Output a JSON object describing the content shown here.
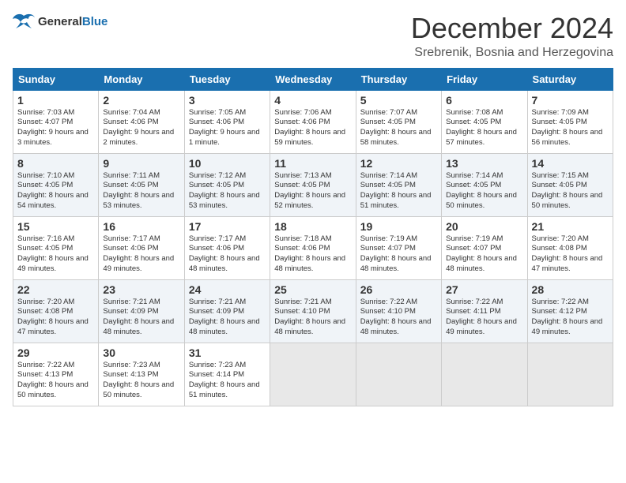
{
  "header": {
    "logo": {
      "general": "General",
      "blue": "Blue"
    },
    "title": "December 2024",
    "location": "Srebrenik, Bosnia and Herzegovina"
  },
  "calendar": {
    "days_of_week": [
      "Sunday",
      "Monday",
      "Tuesday",
      "Wednesday",
      "Thursday",
      "Friday",
      "Saturday"
    ],
    "weeks": [
      [
        null,
        {
          "day": "2",
          "sunrise": "Sunrise: 7:04 AM",
          "sunset": "Sunset: 4:06 PM",
          "daylight": "Daylight: 9 hours and 2 minutes."
        },
        {
          "day": "3",
          "sunrise": "Sunrise: 7:05 AM",
          "sunset": "Sunset: 4:06 PM",
          "daylight": "Daylight: 9 hours and 1 minute."
        },
        {
          "day": "4",
          "sunrise": "Sunrise: 7:06 AM",
          "sunset": "Sunset: 4:06 PM",
          "daylight": "Daylight: 8 hours and 59 minutes."
        },
        {
          "day": "5",
          "sunrise": "Sunrise: 7:07 AM",
          "sunset": "Sunset: 4:05 PM",
          "daylight": "Daylight: 8 hours and 58 minutes."
        },
        {
          "day": "6",
          "sunrise": "Sunrise: 7:08 AM",
          "sunset": "Sunset: 4:05 PM",
          "daylight": "Daylight: 8 hours and 57 minutes."
        },
        {
          "day": "7",
          "sunrise": "Sunrise: 7:09 AM",
          "sunset": "Sunset: 4:05 PM",
          "daylight": "Daylight: 8 hours and 56 minutes."
        }
      ],
      [
        {
          "day": "1",
          "sunrise": "Sunrise: 7:03 AM",
          "sunset": "Sunset: 4:07 PM",
          "daylight": "Daylight: 9 hours and 3 minutes."
        },
        {
          "day": "9",
          "sunrise": "Sunrise: 7:11 AM",
          "sunset": "Sunset: 4:05 PM",
          "daylight": "Daylight: 8 hours and 53 minutes."
        },
        {
          "day": "10",
          "sunrise": "Sunrise: 7:12 AM",
          "sunset": "Sunset: 4:05 PM",
          "daylight": "Daylight: 8 hours and 53 minutes."
        },
        {
          "day": "11",
          "sunrise": "Sunrise: 7:13 AM",
          "sunset": "Sunset: 4:05 PM",
          "daylight": "Daylight: 8 hours and 52 minutes."
        },
        {
          "day": "12",
          "sunrise": "Sunrise: 7:14 AM",
          "sunset": "Sunset: 4:05 PM",
          "daylight": "Daylight: 8 hours and 51 minutes."
        },
        {
          "day": "13",
          "sunrise": "Sunrise: 7:14 AM",
          "sunset": "Sunset: 4:05 PM",
          "daylight": "Daylight: 8 hours and 50 minutes."
        },
        {
          "day": "14",
          "sunrise": "Sunrise: 7:15 AM",
          "sunset": "Sunset: 4:05 PM",
          "daylight": "Daylight: 8 hours and 50 minutes."
        }
      ],
      [
        {
          "day": "8",
          "sunrise": "Sunrise: 7:10 AM",
          "sunset": "Sunset: 4:05 PM",
          "daylight": "Daylight: 8 hours and 54 minutes."
        },
        {
          "day": "16",
          "sunrise": "Sunrise: 7:17 AM",
          "sunset": "Sunset: 4:06 PM",
          "daylight": "Daylight: 8 hours and 49 minutes."
        },
        {
          "day": "17",
          "sunrise": "Sunrise: 7:17 AM",
          "sunset": "Sunset: 4:06 PM",
          "daylight": "Daylight: 8 hours and 48 minutes."
        },
        {
          "day": "18",
          "sunrise": "Sunrise: 7:18 AM",
          "sunset": "Sunset: 4:06 PM",
          "daylight": "Daylight: 8 hours and 48 minutes."
        },
        {
          "day": "19",
          "sunrise": "Sunrise: 7:19 AM",
          "sunset": "Sunset: 4:07 PM",
          "daylight": "Daylight: 8 hours and 48 minutes."
        },
        {
          "day": "20",
          "sunrise": "Sunrise: 7:19 AM",
          "sunset": "Sunset: 4:07 PM",
          "daylight": "Daylight: 8 hours and 48 minutes."
        },
        {
          "day": "21",
          "sunrise": "Sunrise: 7:20 AM",
          "sunset": "Sunset: 4:08 PM",
          "daylight": "Daylight: 8 hours and 47 minutes."
        }
      ],
      [
        {
          "day": "15",
          "sunrise": "Sunrise: 7:16 AM",
          "sunset": "Sunset: 4:05 PM",
          "daylight": "Daylight: 8 hours and 49 minutes."
        },
        {
          "day": "23",
          "sunrise": "Sunrise: 7:21 AM",
          "sunset": "Sunset: 4:09 PM",
          "daylight": "Daylight: 8 hours and 48 minutes."
        },
        {
          "day": "24",
          "sunrise": "Sunrise: 7:21 AM",
          "sunset": "Sunset: 4:09 PM",
          "daylight": "Daylight: 8 hours and 48 minutes."
        },
        {
          "day": "25",
          "sunrise": "Sunrise: 7:21 AM",
          "sunset": "Sunset: 4:10 PM",
          "daylight": "Daylight: 8 hours and 48 minutes."
        },
        {
          "day": "26",
          "sunrise": "Sunrise: 7:22 AM",
          "sunset": "Sunset: 4:10 PM",
          "daylight": "Daylight: 8 hours and 48 minutes."
        },
        {
          "day": "27",
          "sunrise": "Sunrise: 7:22 AM",
          "sunset": "Sunset: 4:11 PM",
          "daylight": "Daylight: 8 hours and 49 minutes."
        },
        {
          "day": "28",
          "sunrise": "Sunrise: 7:22 AM",
          "sunset": "Sunset: 4:12 PM",
          "daylight": "Daylight: 8 hours and 49 minutes."
        }
      ],
      [
        {
          "day": "22",
          "sunrise": "Sunrise: 7:20 AM",
          "sunset": "Sunset: 4:08 PM",
          "daylight": "Daylight: 8 hours and 47 minutes."
        },
        {
          "day": "30",
          "sunrise": "Sunrise: 7:23 AM",
          "sunset": "Sunset: 4:13 PM",
          "daylight": "Daylight: 8 hours and 50 minutes."
        },
        {
          "day": "31",
          "sunrise": "Sunrise: 7:23 AM",
          "sunset": "Sunset: 4:14 PM",
          "daylight": "Daylight: 8 hours and 51 minutes."
        },
        null,
        null,
        null,
        null
      ],
      [
        {
          "day": "29",
          "sunrise": "Sunrise: 7:22 AM",
          "sunset": "Sunset: 4:13 PM",
          "daylight": "Daylight: 8 hours and 50 minutes."
        },
        null,
        null,
        null,
        null,
        null,
        null
      ]
    ]
  }
}
